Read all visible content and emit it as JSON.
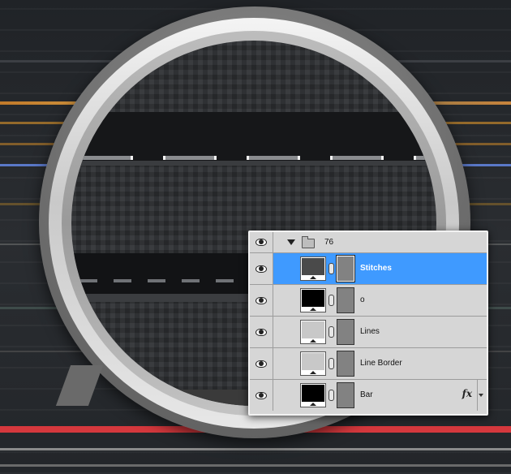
{
  "layers_panel": {
    "group": {
      "name": "76",
      "expanded": true,
      "visible": true
    },
    "layers": [
      {
        "name": "Stitches",
        "selected": true,
        "thumb_color": "#4a4a4a",
        "visible": true,
        "has_fx": false
      },
      {
        "name": "o",
        "selected": false,
        "thumb_color": "#000000",
        "visible": true,
        "has_fx": false
      },
      {
        "name": "Lines",
        "selected": false,
        "thumb_color": "#c8c8c8",
        "visible": true,
        "has_fx": false
      },
      {
        "name": "Line Border",
        "selected": false,
        "thumb_color": "#c8c8c8",
        "visible": true,
        "has_fx": false
      },
      {
        "name": "Bar",
        "selected": false,
        "thumb_color": "#000000",
        "visible": true,
        "has_fx": true
      }
    ],
    "fx_label": "fx",
    "selection_color": "#3f9aff"
  },
  "icons": {
    "visibility": "eye-icon",
    "group_toggle": "triangle-down-icon",
    "group": "folder-icon",
    "link": "chain-link-icon",
    "effects": "fx-icon"
  }
}
